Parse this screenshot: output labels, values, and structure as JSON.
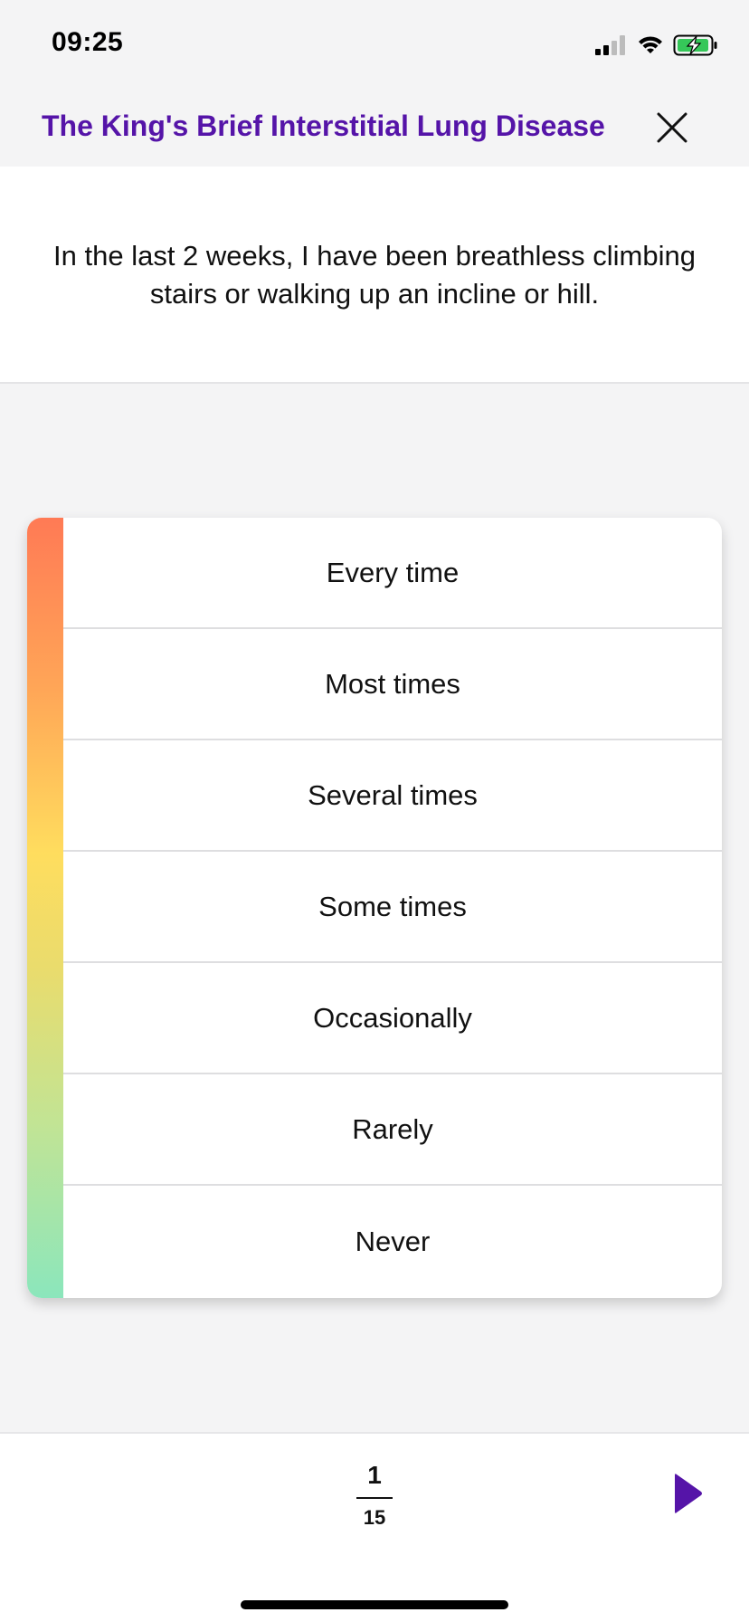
{
  "status_bar": {
    "time": "09:25",
    "icons": [
      "cellular-signal-icon",
      "wifi-icon",
      "battery-charging-icon"
    ]
  },
  "header": {
    "title": "The King's Brief Interstitial Lung Disease",
    "close_icon": "close-icon"
  },
  "question": {
    "text": "In the last 2 weeks, I have been breathless climbing stairs or walking up an incline or hill."
  },
  "options": [
    {
      "label": "Every time"
    },
    {
      "label": "Most times"
    },
    {
      "label": "Several times"
    },
    {
      "label": "Some times"
    },
    {
      "label": "Occasionally"
    },
    {
      "label": "Rarely"
    },
    {
      "label": "Never"
    }
  ],
  "footer": {
    "page_current": "1",
    "page_total": "15",
    "next_icon": "play-right-icon"
  },
  "colors": {
    "accent": "#5514a8",
    "severity_high": "#ff7a55",
    "severity_mid": "#ffdd5e",
    "severity_low": "#8be6bc"
  }
}
